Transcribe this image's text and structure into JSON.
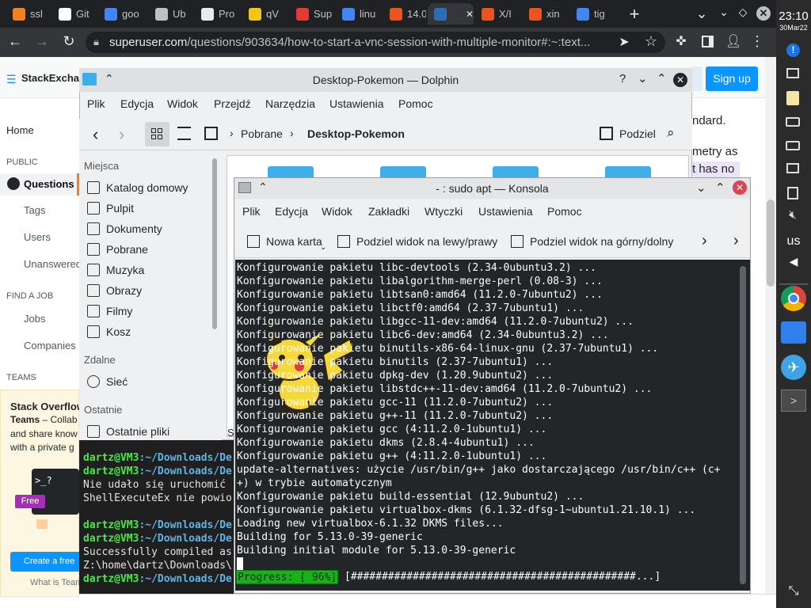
{
  "browser": {
    "tabs": [
      {
        "label": "ssl",
        "favicon": "stack-exchange-icon",
        "color": "#f48024"
      },
      {
        "label": "Git",
        "favicon": "github-icon",
        "color": "#ffffff"
      },
      {
        "label": "goo",
        "favicon": "google-icon",
        "color": "#4285f4"
      },
      {
        "label": "Ub",
        "favicon": "globe-icon",
        "color": "#bdc1c6"
      },
      {
        "label": "Pro",
        "favicon": "a-icon",
        "color": "#e8eaed"
      },
      {
        "label": "qV",
        "favicon": "lp-icon",
        "color": "#f5c518"
      },
      {
        "label": "Sup",
        "favicon": "pdf-icon",
        "color": "#e53935"
      },
      {
        "label": "linu",
        "favicon": "google-icon",
        "color": "#4285f4"
      },
      {
        "label": "14.0",
        "favicon": "askubuntu-icon",
        "color": "#e95420"
      },
      {
        "label": "",
        "favicon": "superuser-icon",
        "color": "#2d6db5"
      },
      {
        "label": "X/I",
        "favicon": "ubuntu-icon",
        "color": "#e95420"
      },
      {
        "label": "xin",
        "favicon": "askubuntu-icon",
        "color": "#e95420"
      },
      {
        "label": "tig",
        "favicon": "google-icon",
        "color": "#4285f4"
      }
    ],
    "new_tab": "+",
    "url_host": "superuser.com",
    "url_path": "/questions/903634/how-to-start-a-vnc-session-with-multiple-monitor#:~:text...",
    "url_value": "superuser.com/questions/903634/how-to-start-a-vnc-session-with-multiple-monitor#:~:text..."
  },
  "shelf": {
    "time": "23:10",
    "date": "30Mar22",
    "lang": "us"
  },
  "stackexchange": {
    "logo": "StackExchan",
    "signup": "Sign up",
    "nav": {
      "home": "Home",
      "public": "PUBLIC",
      "questions": "Questions",
      "tags": "Tags",
      "users": "Users",
      "unanswered": "Unanswered",
      "find_job": "FIND A JOB",
      "jobs": "Jobs",
      "companies": "Companies",
      "teams": "TEAMS"
    },
    "teams_box": {
      "title": "Stack Overflow",
      "title2": "Teams",
      "desc1": " – Collab",
      "desc2": "and share know",
      "desc3": "with a private g",
      "badge": "Free",
      "cta": "Create a free",
      "what": "What is Team"
    },
    "body": {
      "line1": "ndard.",
      "line2": "metry as",
      "line3": "t has no"
    }
  },
  "dolphin": {
    "title": "Desktop-Pokemon — Dolphin",
    "menu": [
      "Plik",
      "Edycja",
      "Widok",
      "Przejdź",
      "Narzędzia",
      "Ustawienia",
      "Pomoc"
    ],
    "breadcrumb": [
      "Pobrane",
      "Desktop-Pokemon"
    ],
    "split": "Podziel",
    "sidebar": {
      "places_header": "Miejsca",
      "places": [
        "Katalog domowy",
        "Pulpit",
        "Dokumenty",
        "Pobrane",
        "Muzyka",
        "Obrazy",
        "Filmy",
        "Kosz"
      ],
      "remote_header": "Zdalne",
      "remote": [
        "Sieć"
      ],
      "recent_header": "Ostatnie",
      "recent": [
        "Ostatnie pliki"
      ]
    },
    "status_fragment": "S"
  },
  "terminal": {
    "lines": [
      {
        "prompt": "dartz@VM3",
        "path": ":~/Downloads/De",
        "text": ""
      },
      {
        "prompt": "dartz@VM3",
        "path": ":~/Downloads/De",
        "text": ""
      },
      {
        "prompt": "",
        "path": "",
        "text": "Nie udało się uruchomić"
      },
      {
        "prompt": "",
        "path": "",
        "text": "ShellExecuteEx nie powio"
      },
      {
        "prompt": "",
        "path": "",
        "text": ""
      },
      {
        "prompt": "dartz@VM3",
        "path": ":~/Downloads/De",
        "text": ""
      },
      {
        "prompt": "dartz@VM3",
        "path": ":~/Downloads/De",
        "text": ""
      },
      {
        "prompt": "",
        "path": "",
        "text": "Successfully compiled as"
      },
      {
        "prompt": "",
        "path": "",
        "text": "Z:\\home\\dartz\\Downloads\\"
      },
      {
        "prompt": "dartz@VM3",
        "path": ":~/Downloads/De",
        "text": ""
      }
    ]
  },
  "konsole": {
    "title": "- : sudo apt — Konsola",
    "menu": [
      "Plik",
      "Edycja",
      "Widok",
      "Zakładki",
      "Wtyczki",
      "Ustawienia",
      "Pomoc"
    ],
    "toolbar": {
      "new_tab": "Nowa karta",
      "split_lr": "Podziel widok na lewy/prawy",
      "split_tb": "Podziel widok na górny/dolny"
    },
    "output": [
      "Konfigurowanie pakietu libc-devtools (2.34-0ubuntu3.2) ...",
      "Konfigurowanie pakietu libalgorithm-merge-perl (0.08-3) ...",
      "Konfigurowanie pakietu libtsan0:amd64 (11.2.0-7ubuntu2) ...",
      "Konfigurowanie pakietu libctf0:amd64 (2.37-7ubuntu1) ...",
      "Konfigurowanie pakietu libgcc-11-dev:amd64 (11.2.0-7ubuntu2) ...",
      "Konfigurowanie pakietu libc6-dev:amd64 (2.34-0ubuntu3.2) ...",
      "Konfigurowanie pakietu binutils-x86-64-linux-gnu (2.37-7ubuntu1) ...",
      "Konfigurowanie pakietu binutils (2.37-7ubuntu1) ...",
      "Konfigurowanie pakietu dpkg-dev (1.20.9ubuntu2) ...",
      "Konfigurowanie pakietu libstdc++-11-dev:amd64 (11.2.0-7ubuntu2) ...",
      "Konfigurowanie pakietu gcc-11 (11.2.0-7ubuntu2) ...",
      "Konfigurowanie pakietu g++-11 (11.2.0-7ubuntu2) ...",
      "Konfigurowanie pakietu gcc (4:11.2.0-1ubuntu1) ...",
      "Konfigurowanie pakietu dkms (2.8.4-4ubuntu1) ...",
      "Konfigurowanie pakietu g++ (4:11.2.0-1ubuntu1) ...",
      "update-alternatives: użycie /usr/bin/g++ jako dostarczającego /usr/bin/c++ (c+",
      "+) w trybie automatycznym",
      "Konfigurowanie pakietu build-essential (12.9ubuntu2) ...",
      "Konfigurowanie pakietu virtualbox-dkms (6.1.32-dfsg-1~ubuntu1.21.10.1) ...",
      "Loading new virtualbox-6.1.32 DKMS files...",
      "Building for 5.13.0-39-generic",
      "Building initial module for 5.13.0-39-generic"
    ],
    "progress_label": "Progress: [ 96%]",
    "progress_bar": "[##############################################...]",
    "progress_percent": 96
  },
  "colors": {
    "chrome_dark": "#202124",
    "chrome_mid": "#35363a",
    "se_blue": "#0a95ff",
    "konsole_bg": "#232629",
    "progress_green": "#18b218",
    "prompt_green": "#4ce64c",
    "path_blue": "#5fb4e5"
  }
}
